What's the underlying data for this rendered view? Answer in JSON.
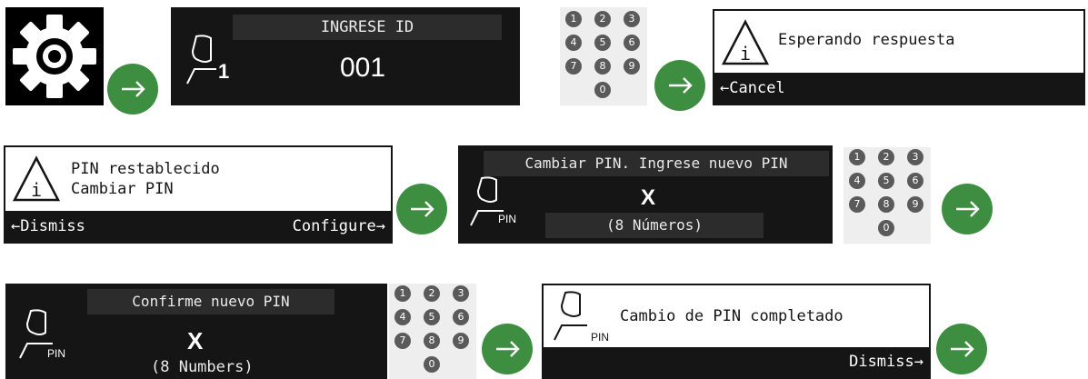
{
  "colors": {
    "accent_green": "#3e8e41",
    "screen_bg": "#151515",
    "bar_bg": "#2c2c2c"
  },
  "keypad": {
    "keys": [
      "1",
      "2",
      "3",
      "4",
      "5",
      "6",
      "7",
      "8",
      "9",
      "0"
    ]
  },
  "row1": {
    "id_screen": {
      "title": "INGRESE ID",
      "user_number": "1",
      "value": "001"
    },
    "wait_dialog": {
      "message": "Esperando respuesta",
      "cancel": "Cancel"
    }
  },
  "row2": {
    "reset_dialog": {
      "line1": "PIN restablecido",
      "line2": "Cambiar PIN",
      "dismiss": "Dismiss",
      "configure": "Configure"
    },
    "new_pin_screen": {
      "title": "Cambiar PIN. Ingrese nuevo PIN",
      "pin_label": "PIN",
      "value": "X",
      "hint": "(8 Números)"
    }
  },
  "row3": {
    "confirm_screen": {
      "title": "Confirme nuevo PIN",
      "pin_label": "PIN",
      "value": "X",
      "hint": "(8 Numbers)"
    },
    "done_dialog": {
      "pin_label": "PIN",
      "message": "Cambio de PIN completado",
      "dismiss": "Dismiss"
    }
  }
}
